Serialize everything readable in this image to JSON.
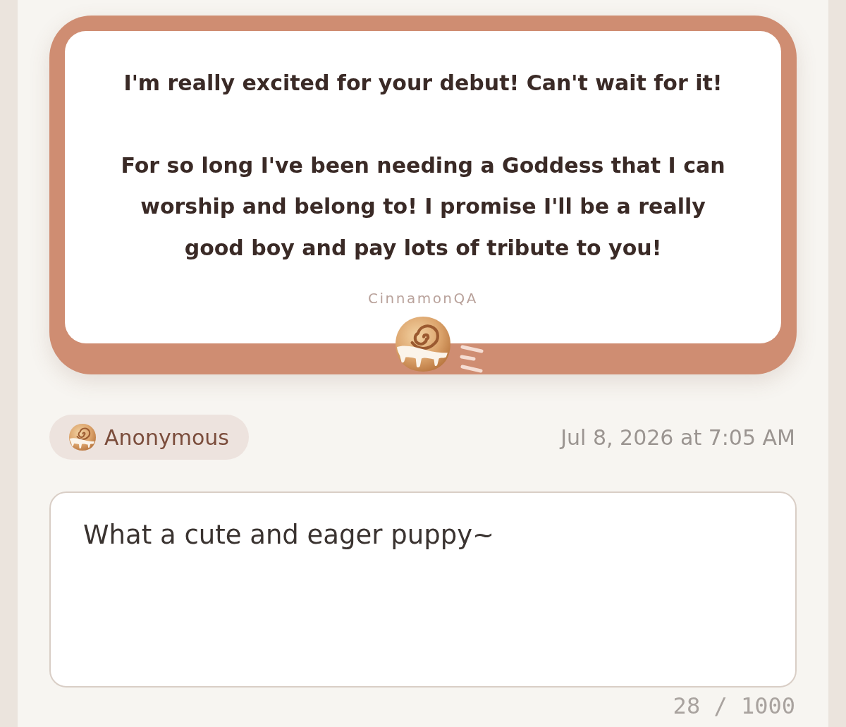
{
  "question_card": {
    "paragraphs": [
      "I'm really excited for your debut! Can't wait for it!",
      "For so long I've been needing a Goddess that I can worship and belong to! I promise I'll be a really good boy and pay lots of tribute to you!"
    ],
    "author": "CinnamonQA"
  },
  "asker": {
    "name": "Anonymous"
  },
  "timestamp": "Jul 8, 2026 at 7:05 AM",
  "answer": {
    "value": "What a cute and eager puppy~",
    "counter": "28 / 1000"
  }
}
